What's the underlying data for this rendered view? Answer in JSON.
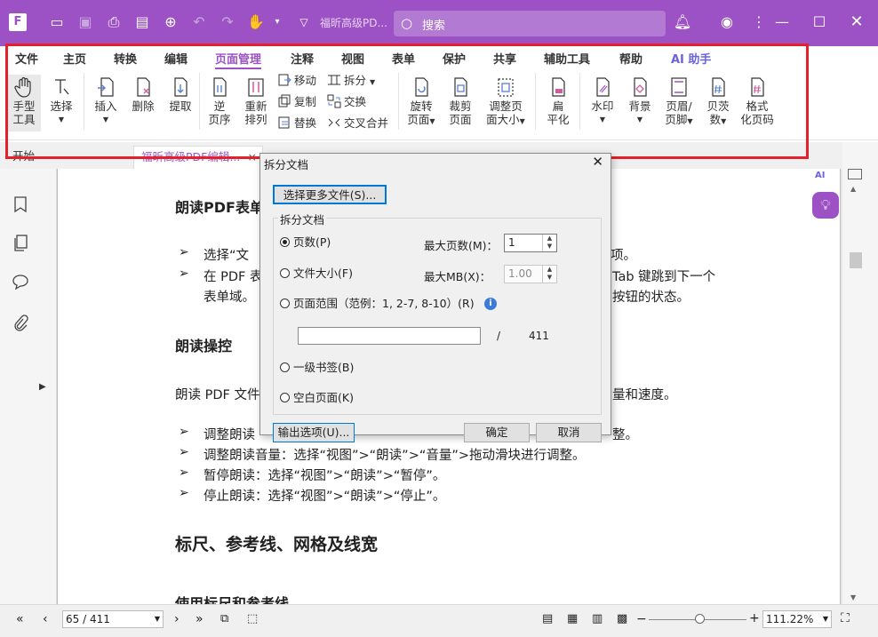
{
  "window": {
    "doc_title": "福昕高级PD...",
    "search_placeholder": "搜索"
  },
  "menu": [
    "文件",
    "主页",
    "转换",
    "编辑",
    "页面管理",
    "注释",
    "视图",
    "表单",
    "保护",
    "共享",
    "辅助工具",
    "帮助",
    "AI 助手"
  ],
  "tools": {
    "hand": "手型\n工具",
    "select": "选择",
    "insert": "插入",
    "delete": "删除",
    "extract": "提取",
    "reverse": "逆\n页序",
    "rearrange": "重新\n排列",
    "move": "移动",
    "copy": "复制",
    "replace": "替换",
    "split": "拆分",
    "swap": "交换",
    "interleave": "交叉合并",
    "rotate": "旋转\n页面",
    "crop": "裁剪\n页面",
    "resize": "调整页\n面大小",
    "flatten": "扁\n平化",
    "watermark": "水印",
    "background": "背景",
    "header_footer": "页眉/\n页脚",
    "bates": "贝茨\n数",
    "format_page_num": "格式\n化页码"
  },
  "tabs": {
    "start": "开始",
    "doc": "福昕高级PDF编辑..."
  },
  "doc": {
    "h_read_form": "朗读PDF表单",
    "b1a": "选择“文",
    "b1b": "项。",
    "b2a": "在 PDF 表",
    "b2b": "Tab 键跳到下一个",
    "b2c": "表单域。",
    "b2d": "按钮的状态。",
    "h_read_ctrl": "朗读操控",
    "p_read": "朗读 PDF 文件",
    "p_read_end": "量和速度。",
    "b3": "调整朗读",
    "b3end": "整。",
    "b4": "调整朗读音量：选择“视图”>“朗读”>“音量”>拖动滑块进行调整。",
    "b5": "暂停朗读：选择“视图”>“朗读”>“暂停”。",
    "b6": "停止朗读：选择“视图”>“朗读”>“停止”。",
    "h_ruler": "标尺、参考线、网格及线宽",
    "h_ruler_use": "使用标尺和参考线"
  },
  "dialog": {
    "title": "拆分文档",
    "select_more": "选择更多文件(S)...",
    "group": "拆分文档",
    "r_pages": "页数(P)",
    "max_pages_label": "最大页数(M)：",
    "max_pages": "1",
    "r_size": "文件大小(F)",
    "max_mb_label": "最大MB(X)：",
    "max_mb": "1.00",
    "r_range": "页面范围（范例：1, 2-7, 8-10）(R)",
    "slash": "/",
    "total": "411",
    "r_bookmark": "一级书签(B)",
    "r_blank": "空白页面(K)",
    "output": "输出选项(U)...",
    "ok": "确定",
    "cancel": "取消"
  },
  "status": {
    "page": "65 / 411",
    "zoom": "111.22%"
  },
  "colors": {
    "accent": "#9c52c4",
    "highlight": "#e4202a"
  }
}
